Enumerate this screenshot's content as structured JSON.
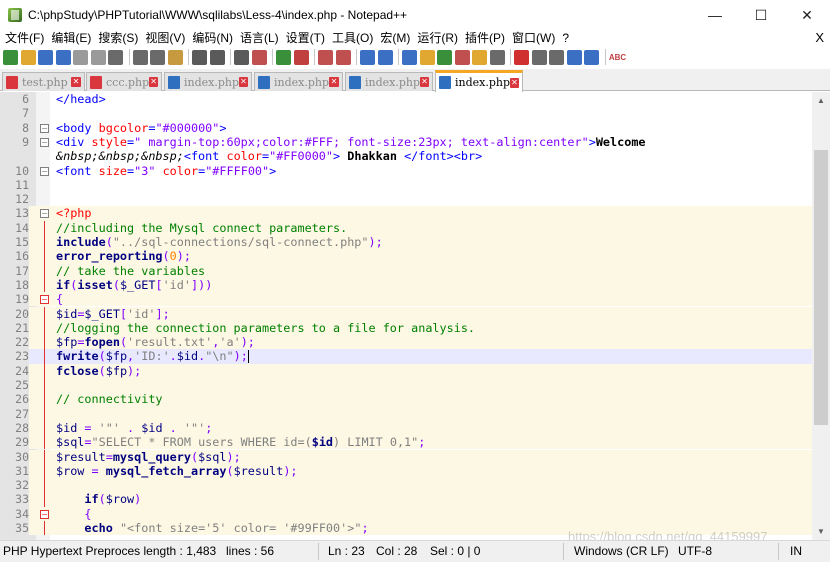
{
  "window": {
    "title": "C:\\phpStudy\\PHPTutorial\\WWW\\sqlilabs\\Less-4\\index.php - Notepad++",
    "minimize": "—",
    "maximize": "☐",
    "close": "✕"
  },
  "menu": {
    "items": [
      "文件(F)",
      "编辑(E)",
      "搜索(S)",
      "视图(V)",
      "编码(N)",
      "语言(L)",
      "设置(T)",
      "工具(O)",
      "宏(M)",
      "运行(R)",
      "插件(P)",
      "窗口(W)",
      "?"
    ],
    "close": "X"
  },
  "toolbar": {
    "buttons": [
      {
        "icon": "new-file-icon",
        "color": "#3a8f3a"
      },
      {
        "icon": "open-file-icon",
        "color": "#e0a830"
      },
      {
        "icon": "save-icon",
        "color": "#3b6fc4"
      },
      {
        "icon": "save-all-icon",
        "color": "#3b6fc4"
      },
      {
        "icon": "close-icon",
        "color": "#9a9a9a"
      },
      {
        "icon": "close-all-icon",
        "color": "#9a9a9a"
      },
      {
        "icon": "print-icon",
        "color": "#6a6a6a"
      },
      {
        "sep": true
      },
      {
        "icon": "cut-icon",
        "color": "#6a6a6a"
      },
      {
        "icon": "copy-icon",
        "color": "#6a6a6a"
      },
      {
        "icon": "paste-icon",
        "color": "#c89a40"
      },
      {
        "sep": true
      },
      {
        "icon": "undo-icon",
        "color": "#5a5a5a"
      },
      {
        "icon": "redo-icon",
        "color": "#5a5a5a"
      },
      {
        "sep": true
      },
      {
        "icon": "find-icon",
        "color": "#5a5a5a"
      },
      {
        "icon": "replace-icon",
        "color": "#c05050"
      },
      {
        "sep": true
      },
      {
        "icon": "zoom-in-icon",
        "color": "#3a8f3a"
      },
      {
        "icon": "zoom-out-icon",
        "color": "#c04040"
      },
      {
        "sep": true
      },
      {
        "icon": "sync-vertical-icon",
        "color": "#c05050"
      },
      {
        "icon": "sync-horizontal-icon",
        "color": "#c05050"
      },
      {
        "sep": true
      },
      {
        "icon": "word-wrap-icon",
        "color": "#3b6fc4"
      },
      {
        "icon": "show-all-chars-icon",
        "color": "#3b6fc4"
      },
      {
        "sep": true
      },
      {
        "icon": "indent-guide-icon",
        "color": "#3b6fc4"
      },
      {
        "icon": "language-icon",
        "color": "#e0a830"
      },
      {
        "icon": "doc-map-icon",
        "color": "#3a8f3a"
      },
      {
        "icon": "function-list-icon",
        "color": "#c05050"
      },
      {
        "icon": "folder-workspace-icon",
        "color": "#e0a830"
      },
      {
        "icon": "monitor-icon",
        "color": "#6a6a6a"
      },
      {
        "sep": true
      },
      {
        "icon": "record-macro-icon",
        "color": "#d03030"
      },
      {
        "icon": "stop-macro-icon",
        "color": "#6a6a6a"
      },
      {
        "icon": "play-macro-icon",
        "color": "#6a6a6a"
      },
      {
        "icon": "run-macro-multiple-icon",
        "color": "#3b6fc4"
      },
      {
        "icon": "save-macro-icon",
        "color": "#3b6fc4"
      },
      {
        "sep": true
      },
      {
        "icon": "spell-check-icon",
        "color": "#c04040",
        "label": "ABC"
      }
    ]
  },
  "tabs": [
    {
      "label": "test.php",
      "active": false
    },
    {
      "label": "ccc.php",
      "active": false
    },
    {
      "label": "index.php",
      "active": false
    },
    {
      "label": "index.php",
      "active": false
    },
    {
      "label": "index.php",
      "active": false
    },
    {
      "label": "index.php",
      "active": true
    }
  ],
  "editor": {
    "lines": [
      {
        "n": "6",
        "fold": "",
        "bg": "",
        "tokens": [
          [
            "tag",
            "</head>"
          ]
        ]
      },
      {
        "n": "7",
        "fold": "",
        "bg": "",
        "tokens": []
      },
      {
        "n": "8",
        "fold": "box",
        "bg": "",
        "tokens": [
          [
            "tag",
            "<body "
          ],
          [
            "attr",
            "bgcolor"
          ],
          [
            "tag",
            "="
          ],
          [
            "val",
            "\"#000000\""
          ],
          [
            "tag",
            ">"
          ]
        ]
      },
      {
        "n": "9",
        "fold": "box",
        "bg": "",
        "tokens": [
          [
            "tag",
            "<div "
          ],
          [
            "attr",
            "style"
          ],
          [
            "tag",
            "="
          ],
          [
            "val",
            "\" margin-top:60px;color:#FFF; font-size:23px; text-align:center\""
          ],
          [
            "tag",
            ">"
          ],
          [
            "txt",
            "Welcome"
          ]
        ]
      },
      {
        "n": "",
        "fold": "",
        "bg": "",
        "tokens": [
          [
            "ent",
            "&nbsp;&nbsp;&nbsp;"
          ],
          [
            "tag",
            "<font "
          ],
          [
            "attr",
            "color"
          ],
          [
            "tag",
            "="
          ],
          [
            "val",
            "\"#FF0000\""
          ],
          [
            "tag",
            "> "
          ],
          [
            "txt",
            "Dhakkan "
          ],
          [
            "tag",
            "</font><br>"
          ]
        ]
      },
      {
        "n": "10",
        "fold": "box",
        "bg": "",
        "tokens": [
          [
            "tag",
            "<font "
          ],
          [
            "attr",
            "size"
          ],
          [
            "tag",
            "="
          ],
          [
            "val",
            "\"3\" "
          ],
          [
            "attr",
            "color"
          ],
          [
            "tag",
            "="
          ],
          [
            "val",
            "\"#FFFF00\""
          ],
          [
            "tag",
            ">"
          ]
        ]
      },
      {
        "n": "11",
        "fold": "",
        "bg": "",
        "tokens": []
      },
      {
        "n": "12",
        "fold": "",
        "bg": "",
        "tokens": []
      },
      {
        "n": "13",
        "fold": "box",
        "bg": "php",
        "tokens": [
          [
            "php",
            "<?php"
          ]
        ]
      },
      {
        "n": "14",
        "fold": "bar",
        "bg": "php",
        "tokens": [
          [
            "cm",
            "//including the Mysql connect parameters."
          ]
        ]
      },
      {
        "n": "15",
        "fold": "bar",
        "bg": "php",
        "tokens": [
          [
            "kw",
            "include"
          ],
          [
            "op",
            "("
          ],
          [
            "str",
            "\"../sql-connections/sql-connect.php\""
          ],
          [
            "op",
            ");"
          ]
        ]
      },
      {
        "n": "16",
        "fold": "bar",
        "bg": "php",
        "tokens": [
          [
            "fn",
            "error_reporting"
          ],
          [
            "op",
            "("
          ],
          [
            "num",
            "0"
          ],
          [
            "op",
            ");"
          ]
        ]
      },
      {
        "n": "17",
        "fold": "bar",
        "bg": "php",
        "tokens": [
          [
            "cm",
            "// take the variables"
          ]
        ]
      },
      {
        "n": "18",
        "fold": "bar",
        "bg": "php",
        "tokens": [
          [
            "kw",
            "if"
          ],
          [
            "op",
            "("
          ],
          [
            "kw",
            "isset"
          ],
          [
            "op",
            "("
          ],
          [
            "var",
            "$_GET"
          ],
          [
            "op",
            "["
          ],
          [
            "str",
            "'id'"
          ],
          [
            "op",
            "]))"
          ]
        ]
      },
      {
        "n": "19",
        "fold": "boxred",
        "bg": "php",
        "tokens": [
          [
            "op",
            "{"
          ]
        ]
      },
      {
        "n": "20",
        "fold": "bar",
        "bg": "php",
        "tokens": [
          [
            "var",
            "$id"
          ],
          [
            "op",
            "="
          ],
          [
            "var",
            "$_GET"
          ],
          [
            "op",
            "["
          ],
          [
            "str",
            "'id'"
          ],
          [
            "op",
            "];"
          ]
        ]
      },
      {
        "n": "21",
        "fold": "bar",
        "bg": "php",
        "tokens": [
          [
            "cm",
            "//logging the connection parameters to a file for analysis."
          ]
        ]
      },
      {
        "n": "22",
        "fold": "bar",
        "bg": "php",
        "tokens": [
          [
            "var",
            "$fp"
          ],
          [
            "op",
            "="
          ],
          [
            "fn",
            "fopen"
          ],
          [
            "op",
            "("
          ],
          [
            "str",
            "'result.txt'"
          ],
          [
            "op",
            ","
          ],
          [
            "str",
            "'a'"
          ],
          [
            "op",
            ");"
          ]
        ]
      },
      {
        "n": "23",
        "fold": "bar",
        "bg": "cur",
        "tokens": [
          [
            "fn",
            "fwrite"
          ],
          [
            "op",
            "("
          ],
          [
            "var",
            "$fp"
          ],
          [
            "op",
            ","
          ],
          [
            "str",
            "'ID:'"
          ],
          [
            "op",
            "."
          ],
          [
            "var",
            "$id"
          ],
          [
            "op",
            "."
          ],
          [
            "str",
            "\"\\n\""
          ],
          [
            "op",
            ");"
          ],
          [
            "caret",
            ""
          ]
        ]
      },
      {
        "n": "24",
        "fold": "bar",
        "bg": "php",
        "tokens": [
          [
            "fn",
            "fclose"
          ],
          [
            "op",
            "("
          ],
          [
            "var",
            "$fp"
          ],
          [
            "op",
            ");"
          ]
        ]
      },
      {
        "n": "25",
        "fold": "bar",
        "bg": "php",
        "tokens": []
      },
      {
        "n": "26",
        "fold": "bar",
        "bg": "php",
        "tokens": [
          [
            "cm",
            "// connectivity"
          ]
        ]
      },
      {
        "n": "27",
        "fold": "bar",
        "bg": "php",
        "tokens": []
      },
      {
        "n": "28",
        "fold": "bar",
        "bg": "php",
        "tokens": [
          [
            "var",
            "$id"
          ],
          [
            "op",
            " = "
          ],
          [
            "str",
            "'\"'"
          ],
          [
            "op",
            " . "
          ],
          [
            "var",
            "$id"
          ],
          [
            "op",
            " . "
          ],
          [
            "str",
            "'\"'"
          ],
          [
            "op",
            ";"
          ]
        ]
      },
      {
        "n": "29",
        "fold": "bar",
        "bg": "php",
        "tokens": [
          [
            "var",
            "$sql"
          ],
          [
            "op",
            "="
          ],
          [
            "str",
            "\"SELECT * FROM users WHERE id=("
          ],
          [
            "kw",
            "$id"
          ],
          [
            "str",
            ") LIMIT 0,1\""
          ],
          [
            "op",
            ";"
          ]
        ]
      },
      {
        "n": "30",
        "fold": "bar",
        "bg": "php",
        "tokens": [
          [
            "var",
            "$result"
          ],
          [
            "op",
            "="
          ],
          [
            "fn",
            "mysql_query"
          ],
          [
            "op",
            "("
          ],
          [
            "var",
            "$sql"
          ],
          [
            "op",
            ");"
          ]
        ]
      },
      {
        "n": "31",
        "fold": "bar",
        "bg": "php",
        "tokens": [
          [
            "var",
            "$row"
          ],
          [
            "op",
            " = "
          ],
          [
            "fn",
            "mysql_fetch_array"
          ],
          [
            "op",
            "("
          ],
          [
            "var",
            "$result"
          ],
          [
            "op",
            ");"
          ]
        ]
      },
      {
        "n": "32",
        "fold": "bar",
        "bg": "php",
        "tokens": []
      },
      {
        "n": "33",
        "fold": "bar",
        "bg": "php",
        "tokens": [
          [
            "plain",
            "    "
          ],
          [
            "kw",
            "if"
          ],
          [
            "op",
            "("
          ],
          [
            "var",
            "$row"
          ],
          [
            "op",
            ")"
          ]
        ]
      },
      {
        "n": "34",
        "fold": "boxred",
        "bg": "php",
        "tokens": [
          [
            "plain",
            "    "
          ],
          [
            "op",
            "{"
          ]
        ]
      },
      {
        "n": "35",
        "fold": "bar",
        "bg": "php",
        "tokens": [
          [
            "plain",
            "    "
          ],
          [
            "kw",
            "echo"
          ],
          [
            "plain",
            " "
          ],
          [
            "str",
            "\"<font size='5' color= '#99FF00'>\""
          ],
          [
            "op",
            ";"
          ]
        ]
      }
    ]
  },
  "status": {
    "filetype": "PHP Hypertext Preproces length : 1,483",
    "lines": "lines : 56",
    "ln": "Ln : 23",
    "col": "Col : 28",
    "sel": "Sel : 0 | 0",
    "eol": "Windows (CR LF)",
    "encoding": "UTF-8",
    "mode": "IN"
  },
  "watermark": "https://blog.csdn.net/qq_44159997"
}
